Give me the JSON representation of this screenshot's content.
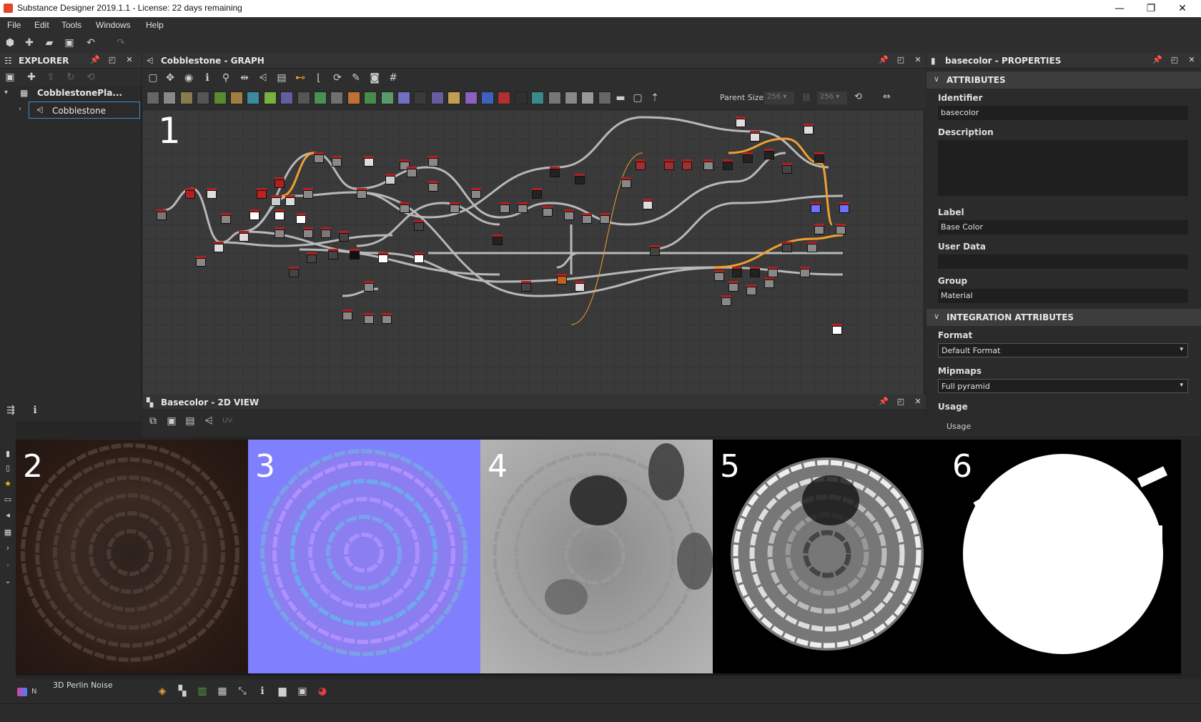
{
  "window": {
    "title": "Substance Designer 2019.1.1 - License: 22 days remaining",
    "controls": [
      "—",
      "❐",
      "✕"
    ]
  },
  "menu": {
    "items": [
      "File",
      "Edit",
      "Tools",
      "Windows",
      "Help"
    ]
  },
  "explorer": {
    "title": "EXPLORER",
    "package": "CobblestonePla...",
    "graph_item": "Cobblestone"
  },
  "graph": {
    "title": "Cobblestone - GRAPH",
    "parent_size_label": "Parent Size:",
    "size_w": "256",
    "size_h": "256",
    "overlay_number": "1"
  },
  "properties": {
    "title": "basecolor - PROPERTIES",
    "attributes_section": "ATTRIBUTES",
    "identifier_label": "Identifier",
    "identifier_value": "basecolor",
    "description_label": "Description",
    "label_label": "Label",
    "label_value": "Base Color",
    "userdata_label": "User Data",
    "group_label": "Group",
    "group_value": "Material",
    "integration_section": "INTEGRATION ATTRIBUTES",
    "format_label": "Format",
    "format_value": "Default Format",
    "mipmaps_label": "Mipmaps",
    "mipmaps_value": "Full pyramid",
    "usage_label": "Usage",
    "usage_value": "Usage"
  },
  "view2d": {
    "title": "Basecolor - 2D VIEW",
    "uv_label": "UV"
  },
  "previews": [
    {
      "num": "2",
      "kind": "basecolor"
    },
    {
      "num": "3",
      "kind": "normal"
    },
    {
      "num": "4",
      "kind": "roughness"
    },
    {
      "num": "5",
      "kind": "height"
    },
    {
      "num": "6",
      "kind": "mask"
    }
  ],
  "library": {
    "item": "3D Perlin Noise",
    "letter": "N"
  },
  "colors": {
    "accent_orange": "#f0a030",
    "node_red": "#b02020",
    "normal_blue": "#8080ff",
    "panel_bg": "#2b2b2b"
  }
}
